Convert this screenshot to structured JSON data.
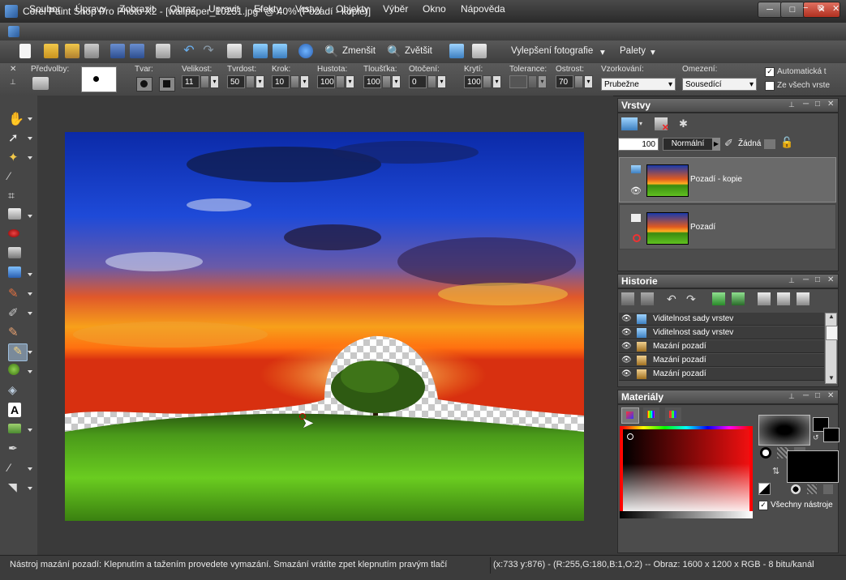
{
  "window": {
    "title": "Corel Paint Shop Pro Photo X2 - [wallpaper_10251.jpg* @  40% (Pozadí - kopie)]",
    "minimize": "─",
    "maximize": "□",
    "close": "✕"
  },
  "menu": {
    "items": [
      "Soubor",
      "Úpravy",
      "Zobrazit",
      "Obraz",
      "Upravit",
      "Efekty",
      "Vrstvy",
      "Objekty",
      "Výběr",
      "Okno",
      "Nápověda"
    ],
    "mdi_buttons": [
      "−",
      "⧉",
      "✕"
    ]
  },
  "toolbar": {
    "zoom_out_label": "Zmenšit",
    "zoom_in_label": "Zvětšit",
    "enhance_label": "Vylepšení fotografie",
    "palettes_label": "Palety"
  },
  "options": {
    "presets_label": "Předvolby:",
    "shape_label": "Tvar:",
    "size_label": "Velikost:",
    "size_value": "11",
    "hardness_label": "Tvrdost:",
    "hardness_value": "50",
    "step_label": "Krok:",
    "step_value": "10",
    "density_label": "Hustota:",
    "density_value": "100",
    "thickness_label": "Tloušťka:",
    "thickness_value": "100",
    "rotation_label": "Otočení:",
    "rotation_value": "0",
    "opacity_label": "Krytí:",
    "opacity_value": "100",
    "tolerance_label": "Tolerance:",
    "tolerance_value": "",
    "sharpness_label": "Ostrost:",
    "sharpness_value": "70",
    "sampling_label": "Vzorkování:",
    "sampling_value": "Prubežne",
    "limits_label": "Omezení:",
    "limits_value": "Sousedící",
    "auto_label": "Automatická t",
    "auto_checked": "✓",
    "all_layers_label": "Ze všech vrste"
  },
  "layers_panel": {
    "title": "Vrstvy",
    "opacity": "100",
    "blend_mode": "Normální",
    "mask_label": "Žádná",
    "layers": [
      {
        "name": "Pozadí - kopie",
        "selected": true
      },
      {
        "name": "Pozadí",
        "selected": false
      }
    ]
  },
  "history_panel": {
    "title": "Historie",
    "items": [
      "Viditelnost sady vrstev",
      "Viditelnost sady vrstev",
      "Mazání pozadí",
      "Mazání pozadí",
      "Mazání pozadí"
    ]
  },
  "materials_panel": {
    "title": "Materiály",
    "all_tools_label": "Všechny nástroje",
    "all_tools_checked": "✓"
  },
  "status": {
    "hint": "Nástroj mazání pozadí: Klepnutím a tažením provedete vymazání. Smazání vrátíte zpet klepnutím pravým tlačí",
    "info": "(x:733 y:876) - (R:255,G:180,B:1,O:2) -- Obraz:  1600 x 1200 x RGB - 8 bitu/kanál"
  },
  "colors": {
    "accent": "#5fa8e0",
    "panel_bg": "#4c4c4c",
    "workspace_bg": "#3a3a3a"
  }
}
